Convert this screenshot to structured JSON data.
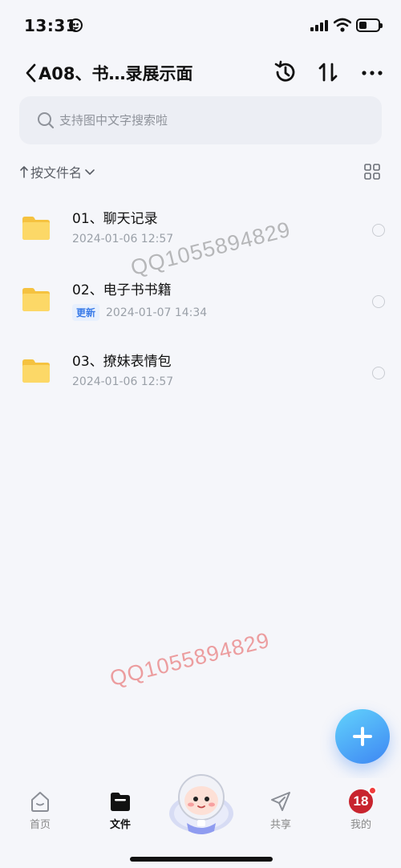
{
  "status_bar": {
    "time": "13:31"
  },
  "nav": {
    "title": "A08、书…录展示面"
  },
  "search": {
    "placeholder": "支持图中文字搜索啦"
  },
  "sort": {
    "label": "按文件名"
  },
  "files": [
    {
      "name": "01、聊天记录",
      "badge": "",
      "date": "2024-01-06 12:57"
    },
    {
      "name": "02、电子书书籍",
      "badge": "更新",
      "date": "2024-01-07 14:34"
    },
    {
      "name": "03、撩妹表情包",
      "badge": "",
      "date": "2024-01-06 12:57"
    }
  ],
  "watermarks": [
    "QQ1055894829",
    "QQ1055894829"
  ],
  "tabs": [
    {
      "label": "首页",
      "icon": "home-icon"
    },
    {
      "label": "文件",
      "icon": "folder-icon"
    },
    {
      "label": "共享",
      "icon": "send-icon"
    },
    {
      "label": "我的",
      "icon": "avatar"
    }
  ],
  "profile_avatar_text": "18",
  "colors": {
    "accent": "#3e86f3",
    "folder": "#fcd867",
    "badge_text": "#3a7be8",
    "avatar": "#c8242e"
  }
}
